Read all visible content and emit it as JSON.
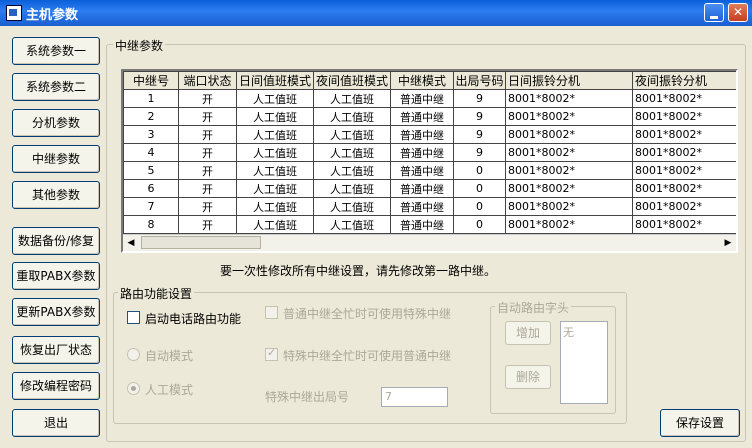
{
  "window": {
    "title": "主机参数"
  },
  "left_buttons": [
    "系统参数一",
    "系统参数二",
    "分机参数",
    "中继参数",
    "其他参数",
    "数据备份/修复",
    "重取PABX参数",
    "更新PABX参数",
    "恢复出厂状态",
    "修改编程密码",
    "退出"
  ],
  "trunk_group": {
    "title": "中继参数"
  },
  "table": {
    "headers": [
      "中继号",
      "端口状态",
      "日间值班模式",
      "夜间值班模式",
      "中继模式",
      "出局号码",
      "日间振铃分机",
      "夜间振铃分机"
    ],
    "rows": [
      [
        "1",
        "开",
        "人工值班",
        "人工值班",
        "普通中继",
        "9",
        "8001*8002*",
        "8001*8002*"
      ],
      [
        "2",
        "开",
        "人工值班",
        "人工值班",
        "普通中继",
        "9",
        "8001*8002*",
        "8001*8002*"
      ],
      [
        "3",
        "开",
        "人工值班",
        "人工值班",
        "普通中继",
        "9",
        "8001*8002*",
        "8001*8002*"
      ],
      [
        "4",
        "开",
        "人工值班",
        "人工值班",
        "普通中继",
        "9",
        "8001*8002*",
        "8001*8002*"
      ],
      [
        "5",
        "开",
        "人工值班",
        "人工值班",
        "普通中继",
        "0",
        "8001*8002*",
        "8001*8002*"
      ],
      [
        "6",
        "开",
        "人工值班",
        "人工值班",
        "普通中继",
        "0",
        "8001*8002*",
        "8001*8002*"
      ],
      [
        "7",
        "开",
        "人工值班",
        "人工值班",
        "普通中继",
        "0",
        "8001*8002*",
        "8001*8002*"
      ],
      [
        "8",
        "开",
        "人工值班",
        "人工值班",
        "普通中继",
        "0",
        "8001*8002*",
        "8001*8002*"
      ]
    ]
  },
  "note": "要一次性修改所有中继设置，请先修改第一路中继。",
  "routing": {
    "title": "路由功能设置",
    "enable_label": "启动电话路由功能",
    "auto_mode": "自动模式",
    "manual_mode": "人工模式",
    "opt1": "普通中继全忙时可使用特殊中继",
    "opt2": "特殊中继全忙时可使用普通中继",
    "special_label": "特殊中继出局号",
    "special_value": "7",
    "prefix_title": "自动路由字头",
    "add_label": "增加",
    "delete_label": "删除",
    "prefix_list": "无"
  },
  "save_label": "保存设置"
}
